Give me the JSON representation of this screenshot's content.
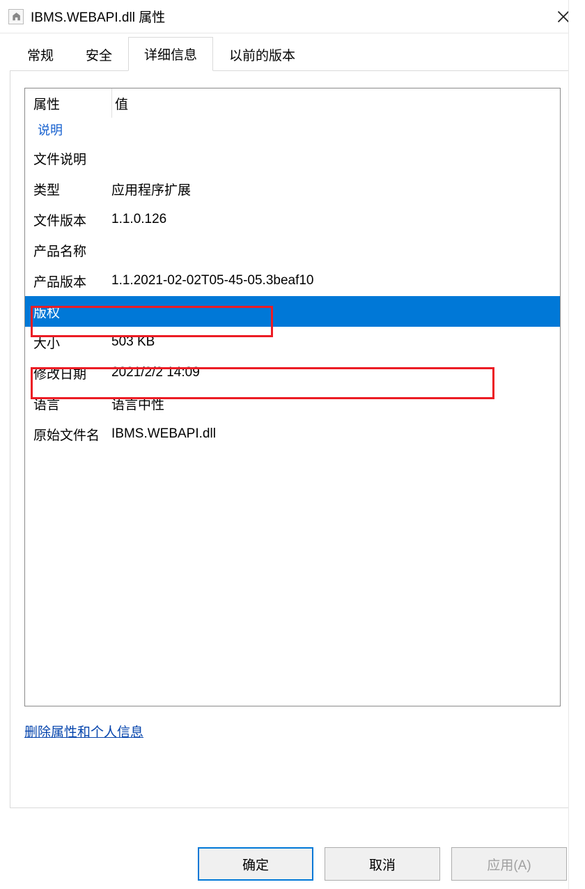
{
  "titlebar": {
    "icon_name": "properties-icon",
    "text": "IBMS.WEBAPI.dll 属性"
  },
  "tabs": [
    {
      "label": "常规"
    },
    {
      "label": "安全"
    },
    {
      "label": "详细信息",
      "active": true
    },
    {
      "label": "以前的版本"
    }
  ],
  "columns": {
    "property": "属性",
    "value": "值"
  },
  "group_label": "说明",
  "rows": [
    {
      "name": "文件说明",
      "value": ""
    },
    {
      "name": "类型",
      "value": "应用程序扩展"
    },
    {
      "name": "文件版本",
      "value": "1.1.0.126",
      "highlight": true
    },
    {
      "name": "产品名称",
      "value": ""
    },
    {
      "name": "产品版本",
      "value": "1.1.2021-02-02T05-45-05.3beaf10",
      "highlight": true
    },
    {
      "name": "版权",
      "value": "",
      "selected": true
    },
    {
      "name": "大小",
      "value": "503 KB"
    },
    {
      "name": "修改日期",
      "value": "2021/2/2 14:09"
    },
    {
      "name": "语言",
      "value": "语言中性"
    },
    {
      "name": "原始文件名",
      "value": "IBMS.WEBAPI.dll"
    }
  ],
  "remove_link": "删除属性和个人信息",
  "buttons": {
    "ok": "确定",
    "cancel": "取消",
    "apply": "应用(A)"
  }
}
